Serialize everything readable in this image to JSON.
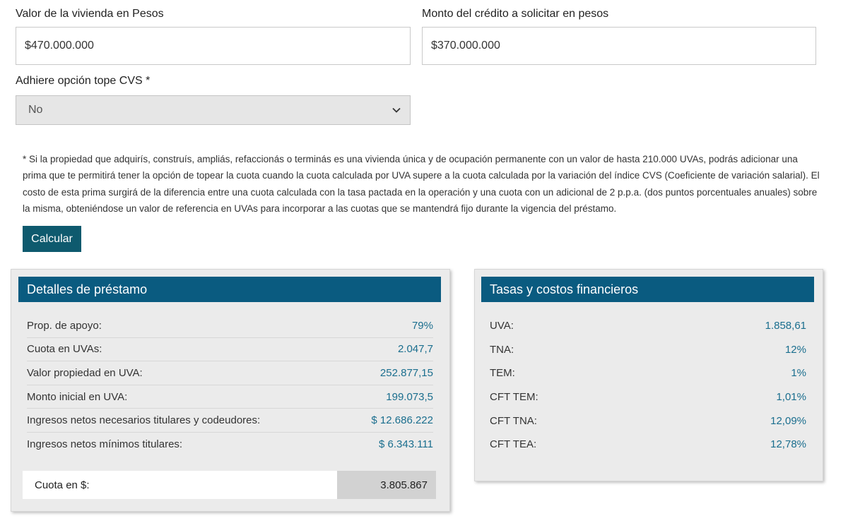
{
  "form": {
    "valor_label": "Valor de la vivienda en Pesos",
    "valor_value": "$470.000.000",
    "monto_label": "Monto del crédito a solicitar en pesos",
    "monto_value": "$370.000.000",
    "cvs_label": "Adhiere opción tope CVS *",
    "cvs_value": "No"
  },
  "disclaimer": "* Si la propiedad que adquirís, construís, ampliás, refaccionás o terminás es una vivienda única y de ocupación permanente con un valor de hasta 210.000 UVAs, podrás adicionar una prima que te permitirá tener la opción de topear la cuota cuando la cuota calculada por UVA supere a la cuota calculada por la variación del índice CVS (Coeficiente de variación salarial). El costo de esta prima surgirá de la diferencia entre una cuota calculada con la tasa pactada en la operación y una cuota con un adicional de 2 p.p.a. (dos puntos porcentuales anuales) sobre la misma, obteniéndose un valor de referencia en UVAs para incorporar a las cuotas que se mantendrá fijo durante la vigencia del préstamo.",
  "button": {
    "calcular": "Calcular"
  },
  "detalles": {
    "title": "Detalles de préstamo",
    "rows": [
      {
        "label": "Prop. de apoyo:",
        "value": "79%"
      },
      {
        "label": "Cuota en UVAs:",
        "value": "2.047,7"
      },
      {
        "label": "Valor propiedad en UVA:",
        "value": "252.877,15"
      },
      {
        "label": "Monto inicial en UVA:",
        "value": "199.073,5"
      },
      {
        "label": "Ingresos netos necesarios titulares y codeudores:",
        "value": "$ 12.686.222"
      },
      {
        "label": "Ingresos netos mínimos titulares:",
        "value": "$ 6.343.111"
      }
    ],
    "total_label": "Cuota en $:",
    "total_value": "3.805.867"
  },
  "tasas": {
    "title": "Tasas y costos financieros",
    "rows": [
      {
        "label": "UVA:",
        "value": "1.858,61"
      },
      {
        "label": "TNA:",
        "value": "12%"
      },
      {
        "label": "TEM:",
        "value": "1%"
      },
      {
        "label": "CFT TEM:",
        "value": "1,01%"
      },
      {
        "label": "CFT TNA:",
        "value": "12,09%"
      },
      {
        "label": "CFT TEA:",
        "value": "12,78%"
      }
    ]
  },
  "icons": {
    "select_arrow": "chevron-down-icon"
  }
}
